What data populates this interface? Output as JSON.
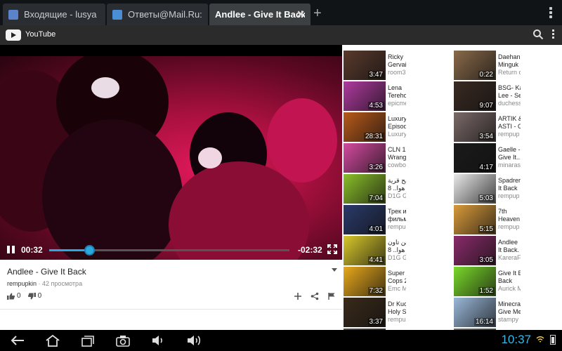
{
  "browser": {
    "tabs": [
      {
        "title": "Входящие - lusya"
      },
      {
        "title": "Ответы@Mail.Ru:"
      },
      {
        "title": "Andlee - Give It Back"
      }
    ]
  },
  "header": {
    "title": "YouTube"
  },
  "player": {
    "elapsed": "00:32",
    "remaining": "-02:32",
    "progress_fraction": 0.17
  },
  "video": {
    "title": "Andlee - Give It Back",
    "channel": "rempupkin",
    "views": "· 42 просмотра",
    "likes": "0",
    "dislikes": "0"
  },
  "related": [
    {
      "line1": "Ricky",
      "line2": "Gervais",
      "channel": "room31",
      "duration": "3:47",
      "color": "#5a3a2c"
    },
    {
      "line1": "Daehan",
      "line2": "Minguk",
      "channel": "Return o",
      "duration": "0:22",
      "color": "#8a6a4a"
    },
    {
      "line1": "Lena",
      "line2": "Terehov",
      "channel": "epicme",
      "duration": "4:53",
      "color": "#b03aa0"
    },
    {
      "line1": "BSG- Ka",
      "line2": "Lee - Se",
      "channel": "duchess",
      "duration": "9:07",
      "color": "#3a2a22"
    },
    {
      "line1": "Luxury I",
      "line2": "Episode",
      "channel": "LuxuryD",
      "duration": "28:31",
      "color": "#b85a1a"
    },
    {
      "line1": "ARTIK &",
      "line2": "ASTI - O",
      "channel": "rempup",
      "duration": "3:54",
      "color": "#7a6a68"
    },
    {
      "line1": "CLN 12",
      "line2": "Wrangle",
      "channel": "cowboy",
      "duration": "3:26",
      "color": "#d44aa0"
    },
    {
      "line1": "Gaelle -",
      "line2": "Give It...",
      "channel": "minaras",
      "duration": "4:17",
      "color": "#1a1a1a"
    },
    {
      "line1": "ربح قرية",
      "line2": "8 ..هوا",
      "channel": "D1G Ga",
      "duration": "7:04",
      "color": "#8abf2a"
    },
    {
      "line1": "Spadrer",
      "line2": "It Back",
      "channel": "rempup",
      "duration": "5:03",
      "color": "#e8e8e8"
    },
    {
      "line1": "Трек из",
      "line2": "фильма",
      "channel": "rempup",
      "duration": "4:01",
      "color": "#2a3a6a"
    },
    {
      "line1": "7th",
      "line2": "Heaven",
      "channel": "rempup",
      "duration": "5:15",
      "color": "#d89a3a"
    },
    {
      "line1": "تتن تاون",
      "line2": "8 ..هوا",
      "channel": "D1G Ga",
      "duration": "4:41",
      "color": "#d8c82a"
    },
    {
      "line1": "Andlee",
      "line2": "It Back.",
      "channel": "KareraF",
      "duration": "3:05",
      "color": "#8a2a6a"
    },
    {
      "line1": "Super N",
      "line2": "Cops 2.",
      "channel": "Emc M",
      "duration": "7:32",
      "color": "#e8a81a"
    },
    {
      "line1": "Give It E",
      "line2": "Back",
      "channel": "Aurick M",
      "duration": "1:52",
      "color": "#7ad82a"
    },
    {
      "line1": "Dr Kuch",
      "line2": "Holy Sp",
      "channel": "rempup",
      "duration": "3:37",
      "color": "#3a2a1a"
    },
    {
      "line1": "Minecra",
      "line2": "Give Me",
      "channel": "stampy",
      "duration": "16:14",
      "color": "#9ab8d8"
    },
    {
      "line1": "",
      "line2": "",
      "channel": "",
      "duration": "",
      "color": "#4a4a4a"
    },
    {
      "line1": "",
      "line2": "",
      "channel": "",
      "duration": "",
      "color": "#6a6a6a"
    }
  ],
  "status": {
    "time": "10:37"
  },
  "colors": {
    "accent": "#2aa9e0",
    "clock": "#39b7e6"
  }
}
